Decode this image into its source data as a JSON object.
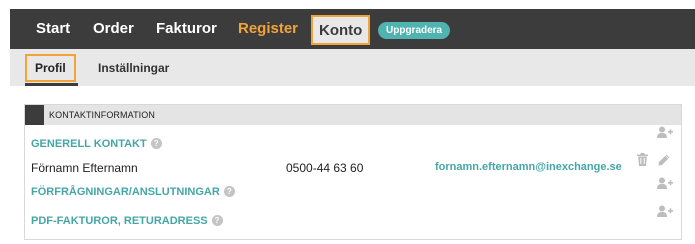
{
  "topnav": {
    "items": [
      {
        "label": "Start"
      },
      {
        "label": "Order"
      },
      {
        "label": "Fakturor"
      },
      {
        "label": "Register"
      },
      {
        "label": "Konto"
      }
    ],
    "upgrade_label": "Uppgradera"
  },
  "subnav": {
    "items": [
      {
        "label": "Profil"
      },
      {
        "label": "Inställningar"
      }
    ]
  },
  "panel": {
    "title": "KONTAKTINFORMATION",
    "sections": [
      {
        "title": "GENERELL KONTAKT"
      },
      {
        "title": "FÖRFRÅGNINGAR/ANSLUTNINGAR"
      },
      {
        "title": "PDF-FAKTUROR, RETURADRESS"
      }
    ],
    "contact": {
      "name": "Förnamn Efternamn",
      "phone": "0500-44 63 60",
      "email": "fornamn.efternamn@inexchange.se"
    },
    "help_glyph": "?"
  },
  "colors": {
    "nav_bg": "#3c3c3c",
    "accent_orange": "#f2a33a",
    "accent_teal": "#45a6a8",
    "badge_teal": "#4fb3b0",
    "subnav_bg": "#e8e8e8"
  },
  "icons": [
    "add-user-icon",
    "trash-icon",
    "pencil-icon",
    "help-icon"
  ]
}
